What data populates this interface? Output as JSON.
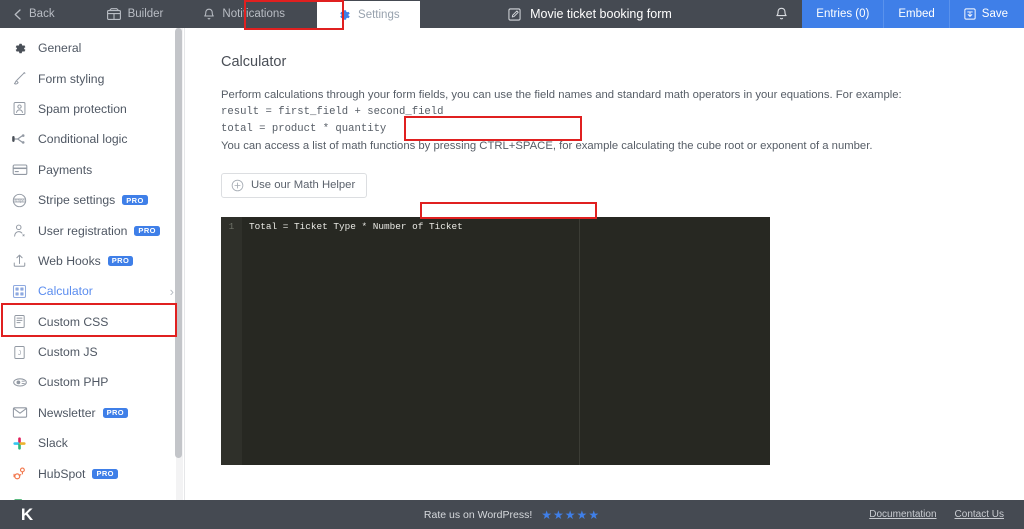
{
  "topbar": {
    "back": "Back",
    "builder": "Builder",
    "notifications": "Notifications",
    "settings": "Settings",
    "form_title": "Movie ticket booking form",
    "entries": "Entries (0)",
    "embed": "Embed",
    "save": "Save"
  },
  "sidebar": {
    "items": [
      {
        "label": "General",
        "icon": "gear-icon",
        "pro": "",
        "active": false,
        "chevron": ""
      },
      {
        "label": "Form styling",
        "icon": "brush-icon",
        "pro": "",
        "active": false,
        "chevron": ""
      },
      {
        "label": "Spam protection",
        "icon": "shield-user-icon",
        "pro": "",
        "active": false,
        "chevron": ""
      },
      {
        "label": "Conditional logic",
        "icon": "branch-icon",
        "pro": "",
        "active": false,
        "chevron": ""
      },
      {
        "label": "Payments",
        "icon": "credit-card-icon",
        "pro": "",
        "active": false,
        "chevron": ""
      },
      {
        "label": "Stripe settings",
        "icon": "stripe-icon",
        "pro": "PRO",
        "active": false,
        "chevron": ""
      },
      {
        "label": "User registration",
        "icon": "user-icon",
        "pro": "PRO",
        "active": false,
        "chevron": ""
      },
      {
        "label": "Web Hooks",
        "icon": "upload-icon",
        "pro": "PRO",
        "active": false,
        "chevron": ""
      },
      {
        "label": "Calculator",
        "icon": "calculator-icon",
        "pro": "",
        "active": true,
        "chevron": "›"
      },
      {
        "label": "Custom CSS",
        "icon": "css-file-icon",
        "pro": "",
        "active": false,
        "chevron": ""
      },
      {
        "label": "Custom JS",
        "icon": "js-file-icon",
        "pro": "",
        "active": false,
        "chevron": ""
      },
      {
        "label": "Custom PHP",
        "icon": "php-eye-icon",
        "pro": "",
        "active": false,
        "chevron": ""
      },
      {
        "label": "Newsletter",
        "icon": "envelope-icon",
        "pro": "PRO",
        "active": false,
        "chevron": ""
      },
      {
        "label": "Slack",
        "icon": "slack-icon",
        "pro": "",
        "active": false,
        "chevron": ""
      },
      {
        "label": "HubSpot",
        "icon": "hubspot-icon",
        "pro": "PRO",
        "active": false,
        "chevron": ""
      }
    ]
  },
  "main": {
    "title": "Calculator",
    "description_1": "Perform calculations through your form fields, you can use the field names and standard math operators in your equations. For example:",
    "example_1": "result = first_field + second_field",
    "example_2": "total = product * quantity",
    "description_2": "You can access a list of math functions by pressing CTRL+SPACE, for example calculating the cube root or exponent of a number.",
    "math_helper_button": "Use our Math Helper",
    "editor": {
      "line_number": "1",
      "line_code": "Total = Ticket Type * Number of Ticket"
    }
  },
  "footer": {
    "logo": "K",
    "rate_text": "Rate us on WordPress!",
    "stars": "★★★★★",
    "documentation": "Documentation",
    "contact": "Contact Us"
  },
  "colors": {
    "topbar_bg": "#454a52",
    "accent_blue": "#3f7fe8",
    "highlight_red": "#e02020",
    "editor_bg": "#272822",
    "active_item": "#5b8def"
  }
}
